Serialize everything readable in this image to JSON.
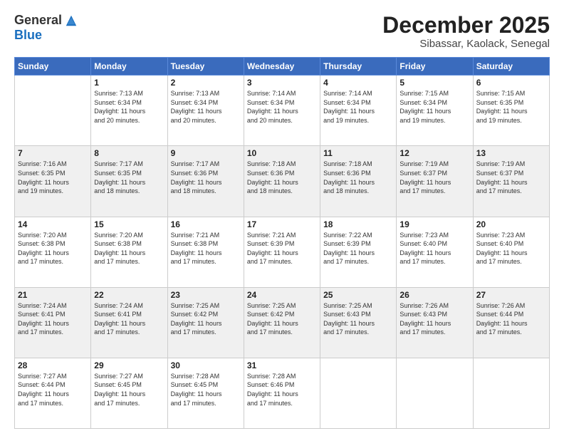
{
  "logo": {
    "general": "General",
    "blue": "Blue"
  },
  "header": {
    "month": "December 2025",
    "location": "Sibassar, Kaolack, Senegal"
  },
  "weekdays": [
    "Sunday",
    "Monday",
    "Tuesday",
    "Wednesday",
    "Thursday",
    "Friday",
    "Saturday"
  ],
  "weeks": [
    [
      {
        "day": "",
        "info": ""
      },
      {
        "day": "1",
        "info": "Sunrise: 7:13 AM\nSunset: 6:34 PM\nDaylight: 11 hours\nand 20 minutes."
      },
      {
        "day": "2",
        "info": "Sunrise: 7:13 AM\nSunset: 6:34 PM\nDaylight: 11 hours\nand 20 minutes."
      },
      {
        "day": "3",
        "info": "Sunrise: 7:14 AM\nSunset: 6:34 PM\nDaylight: 11 hours\nand 20 minutes."
      },
      {
        "day": "4",
        "info": "Sunrise: 7:14 AM\nSunset: 6:34 PM\nDaylight: 11 hours\nand 19 minutes."
      },
      {
        "day": "5",
        "info": "Sunrise: 7:15 AM\nSunset: 6:34 PM\nDaylight: 11 hours\nand 19 minutes."
      },
      {
        "day": "6",
        "info": "Sunrise: 7:15 AM\nSunset: 6:35 PM\nDaylight: 11 hours\nand 19 minutes."
      }
    ],
    [
      {
        "day": "7",
        "info": "Sunrise: 7:16 AM\nSunset: 6:35 PM\nDaylight: 11 hours\nand 19 minutes."
      },
      {
        "day": "8",
        "info": "Sunrise: 7:17 AM\nSunset: 6:35 PM\nDaylight: 11 hours\nand 18 minutes."
      },
      {
        "day": "9",
        "info": "Sunrise: 7:17 AM\nSunset: 6:36 PM\nDaylight: 11 hours\nand 18 minutes."
      },
      {
        "day": "10",
        "info": "Sunrise: 7:18 AM\nSunset: 6:36 PM\nDaylight: 11 hours\nand 18 minutes."
      },
      {
        "day": "11",
        "info": "Sunrise: 7:18 AM\nSunset: 6:36 PM\nDaylight: 11 hours\nand 18 minutes."
      },
      {
        "day": "12",
        "info": "Sunrise: 7:19 AM\nSunset: 6:37 PM\nDaylight: 11 hours\nand 17 minutes."
      },
      {
        "day": "13",
        "info": "Sunrise: 7:19 AM\nSunset: 6:37 PM\nDaylight: 11 hours\nand 17 minutes."
      }
    ],
    [
      {
        "day": "14",
        "info": "Sunrise: 7:20 AM\nSunset: 6:38 PM\nDaylight: 11 hours\nand 17 minutes."
      },
      {
        "day": "15",
        "info": "Sunrise: 7:20 AM\nSunset: 6:38 PM\nDaylight: 11 hours\nand 17 minutes."
      },
      {
        "day": "16",
        "info": "Sunrise: 7:21 AM\nSunset: 6:38 PM\nDaylight: 11 hours\nand 17 minutes."
      },
      {
        "day": "17",
        "info": "Sunrise: 7:21 AM\nSunset: 6:39 PM\nDaylight: 11 hours\nand 17 minutes."
      },
      {
        "day": "18",
        "info": "Sunrise: 7:22 AM\nSunset: 6:39 PM\nDaylight: 11 hours\nand 17 minutes."
      },
      {
        "day": "19",
        "info": "Sunrise: 7:23 AM\nSunset: 6:40 PM\nDaylight: 11 hours\nand 17 minutes."
      },
      {
        "day": "20",
        "info": "Sunrise: 7:23 AM\nSunset: 6:40 PM\nDaylight: 11 hours\nand 17 minutes."
      }
    ],
    [
      {
        "day": "21",
        "info": "Sunrise: 7:24 AM\nSunset: 6:41 PM\nDaylight: 11 hours\nand 17 minutes."
      },
      {
        "day": "22",
        "info": "Sunrise: 7:24 AM\nSunset: 6:41 PM\nDaylight: 11 hours\nand 17 minutes."
      },
      {
        "day": "23",
        "info": "Sunrise: 7:25 AM\nSunset: 6:42 PM\nDaylight: 11 hours\nand 17 minutes."
      },
      {
        "day": "24",
        "info": "Sunrise: 7:25 AM\nSunset: 6:42 PM\nDaylight: 11 hours\nand 17 minutes."
      },
      {
        "day": "25",
        "info": "Sunrise: 7:25 AM\nSunset: 6:43 PM\nDaylight: 11 hours\nand 17 minutes."
      },
      {
        "day": "26",
        "info": "Sunrise: 7:26 AM\nSunset: 6:43 PM\nDaylight: 11 hours\nand 17 minutes."
      },
      {
        "day": "27",
        "info": "Sunrise: 7:26 AM\nSunset: 6:44 PM\nDaylight: 11 hours\nand 17 minutes."
      }
    ],
    [
      {
        "day": "28",
        "info": "Sunrise: 7:27 AM\nSunset: 6:44 PM\nDaylight: 11 hours\nand 17 minutes."
      },
      {
        "day": "29",
        "info": "Sunrise: 7:27 AM\nSunset: 6:45 PM\nDaylight: 11 hours\nand 17 minutes."
      },
      {
        "day": "30",
        "info": "Sunrise: 7:28 AM\nSunset: 6:45 PM\nDaylight: 11 hours\nand 17 minutes."
      },
      {
        "day": "31",
        "info": "Sunrise: 7:28 AM\nSunset: 6:46 PM\nDaylight: 11 hours\nand 17 minutes."
      },
      {
        "day": "",
        "info": ""
      },
      {
        "day": "",
        "info": ""
      },
      {
        "day": "",
        "info": ""
      }
    ]
  ]
}
